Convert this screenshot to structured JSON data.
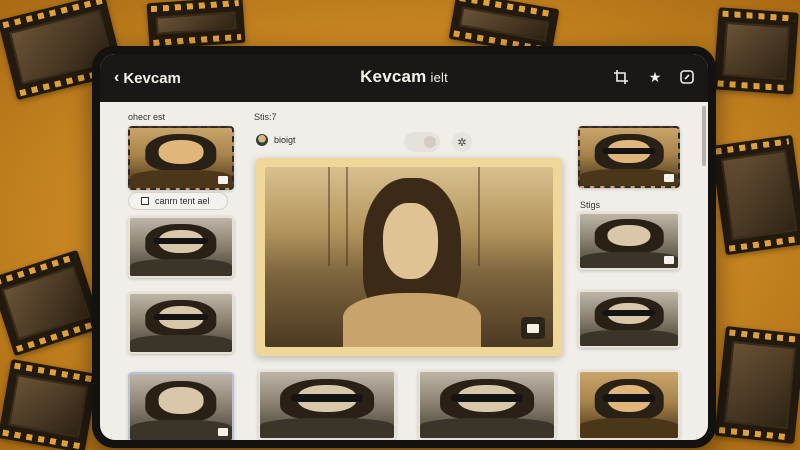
{
  "app": {
    "back_label": "Kevcam",
    "title": "Kevcam",
    "title_suffix": "ielt"
  },
  "toolbar": {
    "icons": [
      "crop-icon",
      "star-icon",
      "edit-icon"
    ]
  },
  "left_panel": {
    "header": "ohecr est",
    "chip_label": "canrn tent ael"
  },
  "center": {
    "header": "Stis:7",
    "filter_label": "bioigt"
  },
  "right_panel": {
    "header": "Stigs"
  },
  "colors": {
    "topbar": "#1a1816",
    "frame": "#efd79a",
    "backdrop": "#e7a93a"
  }
}
